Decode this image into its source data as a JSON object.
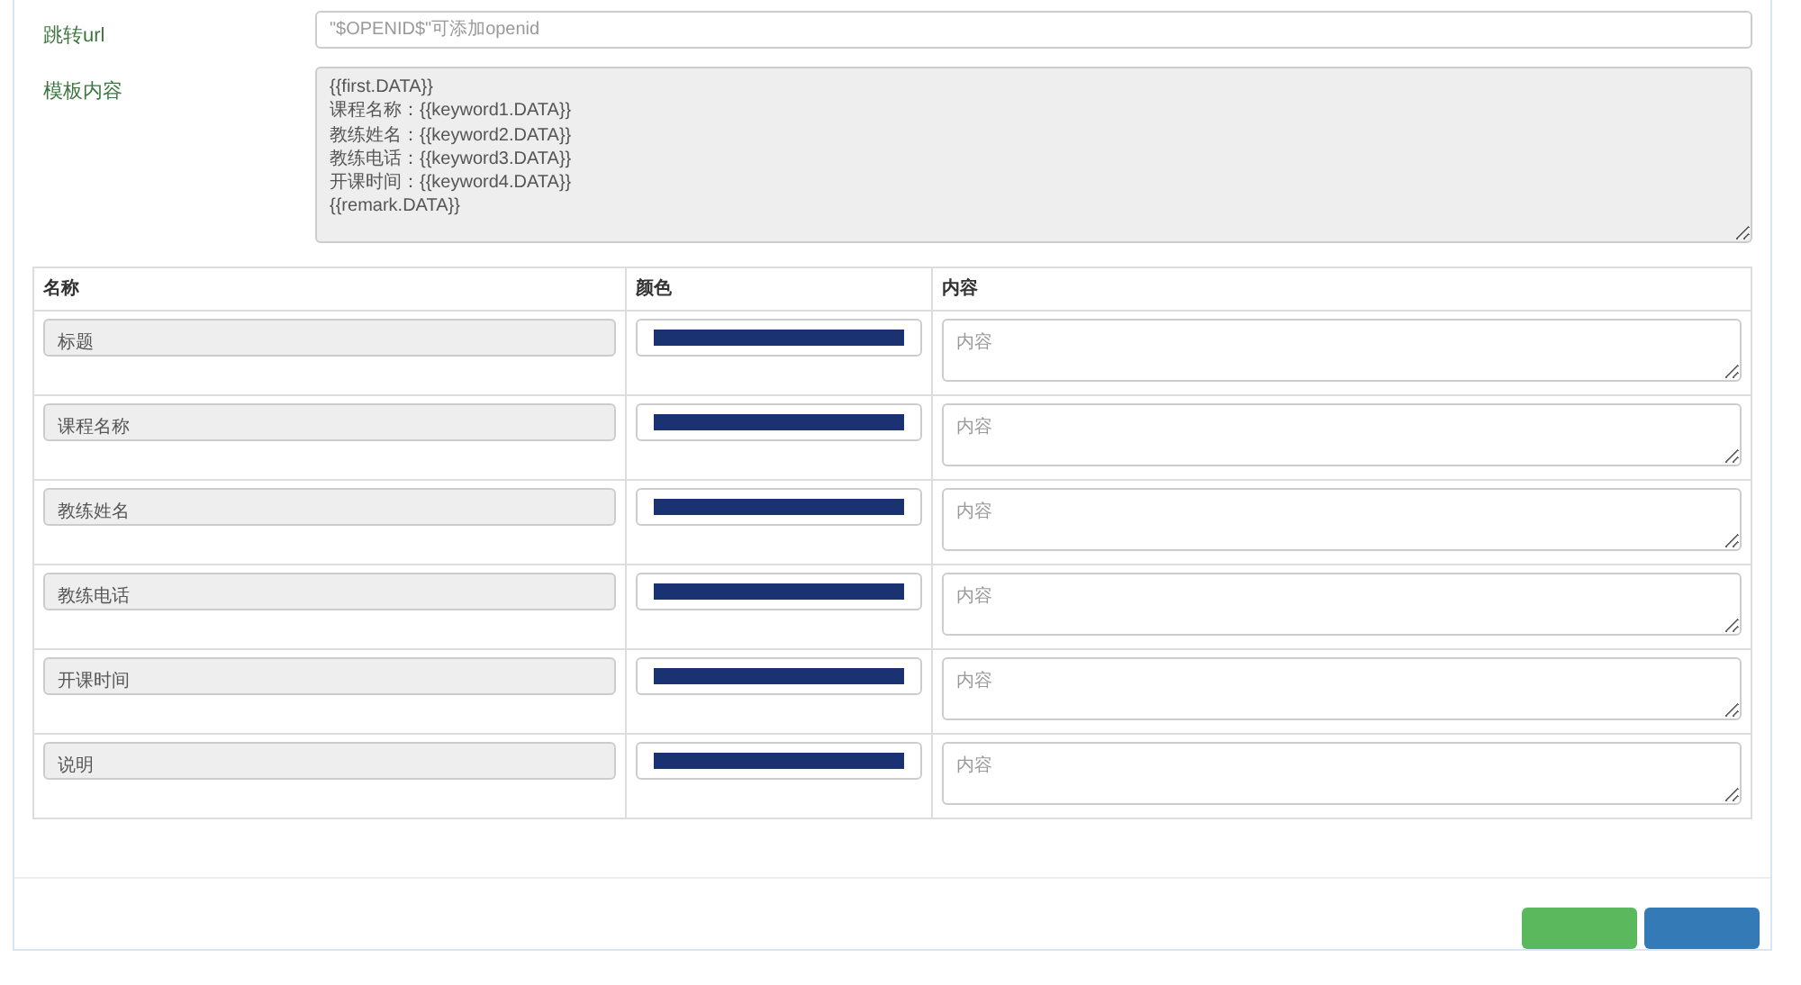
{
  "form": {
    "fields": [
      {
        "kind": "input",
        "label": "跳转url",
        "placeholder": "\"$OPENID$\"可添加openid"
      },
      {
        "kind": "textarea",
        "label": "模板内容",
        "value": "{{first.DATA}}\n课程名称：{{keyword1.DATA}}\n教练姓名：{{keyword2.DATA}}\n教练电话：{{keyword3.DATA}}\n开课时间：{{keyword4.DATA}}\n{{remark.DATA}}",
        "disabled": true
      }
    ]
  },
  "table": {
    "columns": [
      "名称",
      "颜色",
      "内容"
    ],
    "rows": [
      {
        "name": "标题",
        "color": "#1b3272",
        "placeholder": "内容"
      },
      {
        "name": "课程名称",
        "color": "#1b3272",
        "placeholder": "内容"
      },
      {
        "name": "教练姓名",
        "color": "#1b3272",
        "placeholder": "内容"
      },
      {
        "name": "教练电话",
        "color": "#1b3272",
        "placeholder": "内容"
      },
      {
        "name": "开课时间",
        "color": "#1b3272",
        "placeholder": "内容"
      },
      {
        "name": "说明",
        "color": "#1b3272",
        "placeholder": "内容"
      }
    ]
  },
  "footer": {
    "buttons": [
      {
        "kind": "success"
      },
      {
        "kind": "primary"
      }
    ]
  }
}
